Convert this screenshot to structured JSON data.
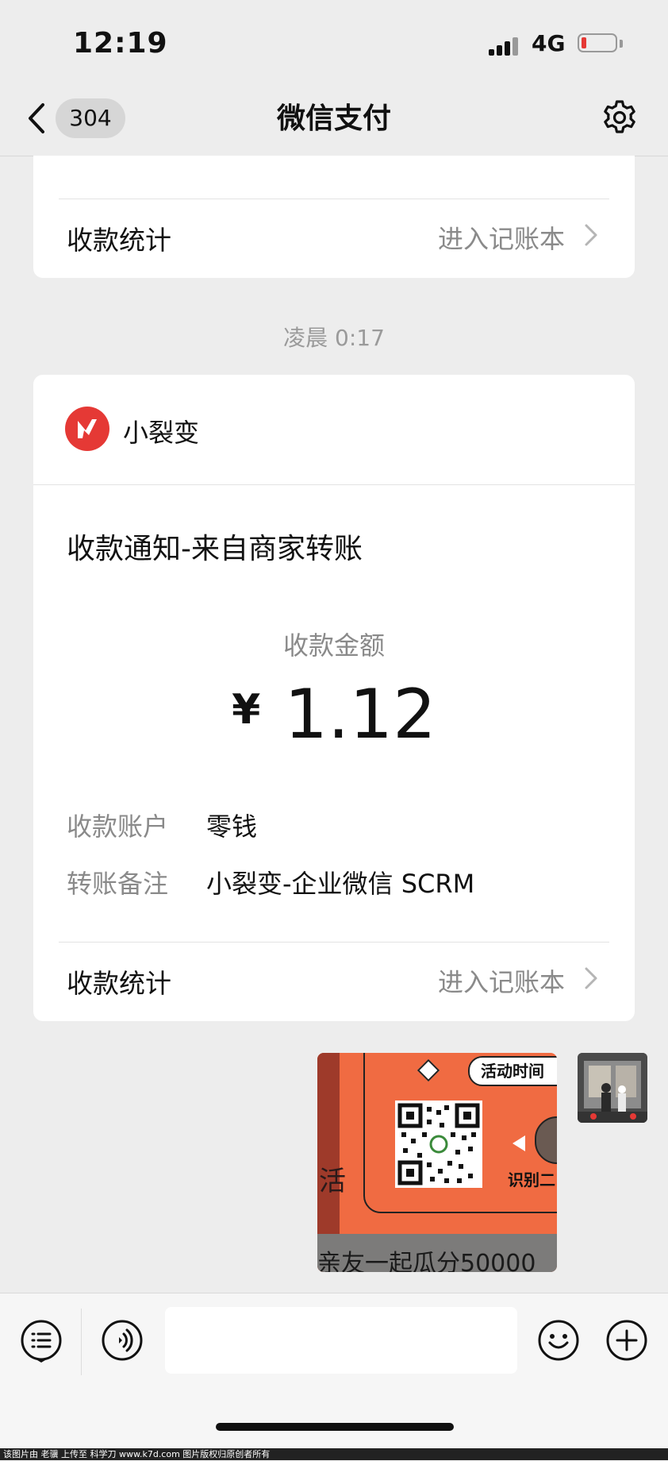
{
  "status_bar": {
    "time": "12:19",
    "network": "4G"
  },
  "nav": {
    "badge_count": "304",
    "title": "微信支付"
  },
  "top_card": {
    "stats_label": "收款统计",
    "ledger_link": "进入记账本"
  },
  "timestamp": "凌晨 0:17",
  "payment_card": {
    "merchant_name": "小裂变",
    "notice_title": "收款通知-来自商家转账",
    "amount_label": "收款金额",
    "currency_symbol": "¥",
    "amount": "1.12",
    "details": [
      {
        "key": "收款账户",
        "value": "零钱"
      },
      {
        "key": "转账备注",
        "value": "小裂变-企业微信 SCRM"
      }
    ],
    "stats_label": "收款统计",
    "ledger_link": "进入记账本"
  },
  "image_message": {
    "badge_text": "活动时间",
    "side_text": "识别二",
    "left_char": "活",
    "bottom_text": "亲友一起瓜分50000"
  },
  "footer_watermark": "该图片由 老骥 上传至 科学刀 www.k7d.com 图片版权归原创者所有",
  "colors": {
    "accent_red": "#e53935",
    "poster_orange": "#f06b42",
    "background": "#ededed"
  }
}
